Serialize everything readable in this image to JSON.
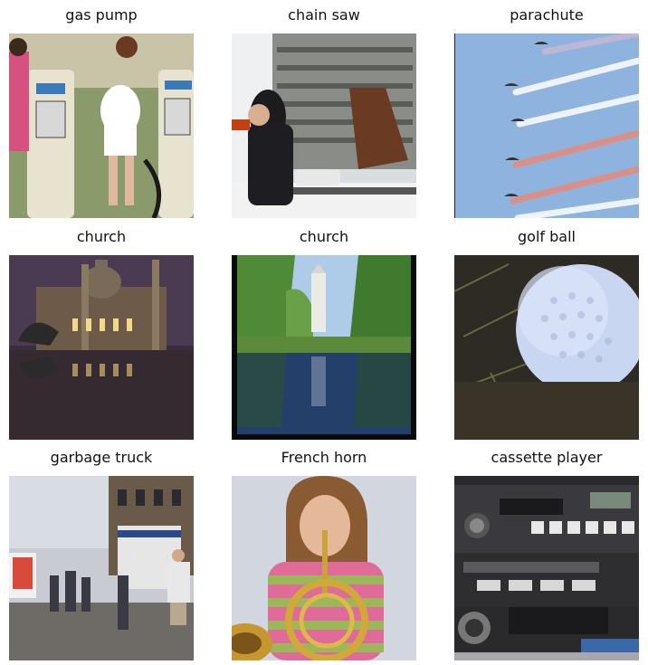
{
  "grid": {
    "items": [
      {
        "label": "gas pump"
      },
      {
        "label": "chain saw"
      },
      {
        "label": "parachute"
      },
      {
        "label": "church"
      },
      {
        "label": "church"
      },
      {
        "label": "golf ball"
      },
      {
        "label": "garbage truck"
      },
      {
        "label": "French horn"
      },
      {
        "label": "cassette player"
      }
    ]
  }
}
